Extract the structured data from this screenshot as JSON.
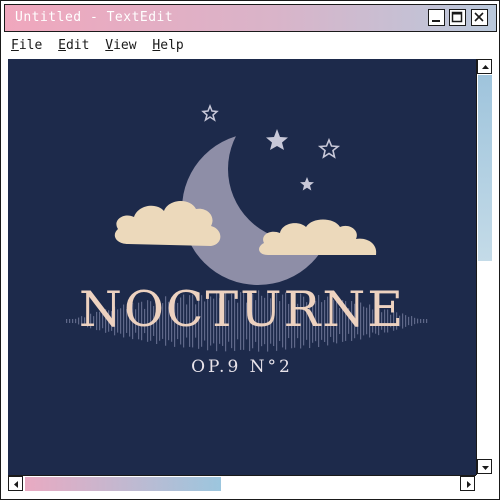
{
  "window": {
    "title": "Untitled - TextEdit",
    "buttons": [
      "minimize",
      "maximize",
      "close"
    ]
  },
  "menubar": {
    "items": [
      {
        "label": "File",
        "mnemonic": "F",
        "rest": "ile"
      },
      {
        "label": "Edit",
        "mnemonic": "E",
        "rest": "dit"
      },
      {
        "label": "View",
        "mnemonic": "V",
        "rest": "iew"
      },
      {
        "label": "Help",
        "mnemonic": "H",
        "rest": "elp"
      }
    ]
  },
  "artwork": {
    "title": "NOCTURNE",
    "subtitle": "OP.9 N°2",
    "icons": [
      "crescent-moon-icon",
      "star-icon",
      "cloud-icon",
      "soundwave-icon"
    ]
  },
  "colors": {
    "background": "#1d2a4b",
    "moon": "#8e8ea7",
    "cloud": "#ecd9bb",
    "title": "#edd2c0",
    "titlebar_start": "#f0a7bd",
    "titlebar_end": "#b9c8db"
  }
}
